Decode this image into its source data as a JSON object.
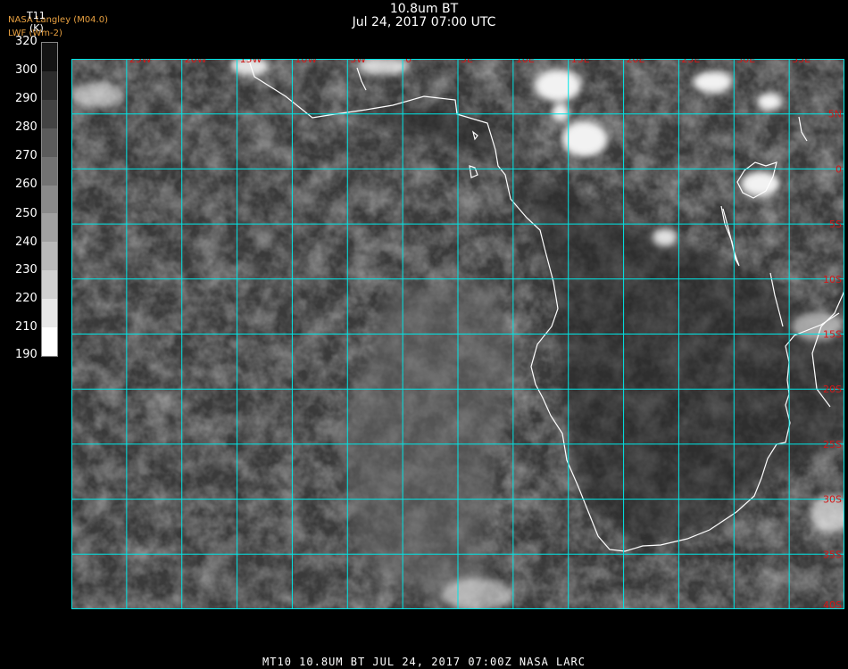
{
  "header": {
    "title": "10.8um BT",
    "date_time": "Jul 24, 2017 07:00 UTC",
    "credit_line1": "NASA Langley (M04.0)",
    "credit_line2": "LWF (Wm-2)"
  },
  "colorbar": {
    "param": "T11",
    "units": "(K)",
    "labels": [
      "320",
      "300",
      "290",
      "280",
      "270",
      "260",
      "250",
      "240",
      "230",
      "220",
      "210",
      "190"
    ]
  },
  "map": {
    "background_color": "#3a3a3a",
    "grid_color": "#00e5e5",
    "coast_color": "#ffffff",
    "label_color": "#d01818",
    "lon_range": [
      -30,
      40
    ],
    "lat_range": [
      -40,
      10
    ],
    "lon_labels": [
      "25W",
      "20W",
      "15W",
      "10W",
      "5W",
      "0",
      "5E",
      "10E",
      "15E",
      "20E",
      "25E",
      "30E",
      "35E"
    ],
    "lat_labels": [
      "5N",
      "0",
      "5S",
      "10S",
      "15S",
      "20S",
      "25S",
      "30S",
      "35S",
      "40S"
    ]
  },
  "footer": {
    "text": "MT10  10.8UM BT   JUL 24, 2017 07:00Z   NASA LARC"
  }
}
